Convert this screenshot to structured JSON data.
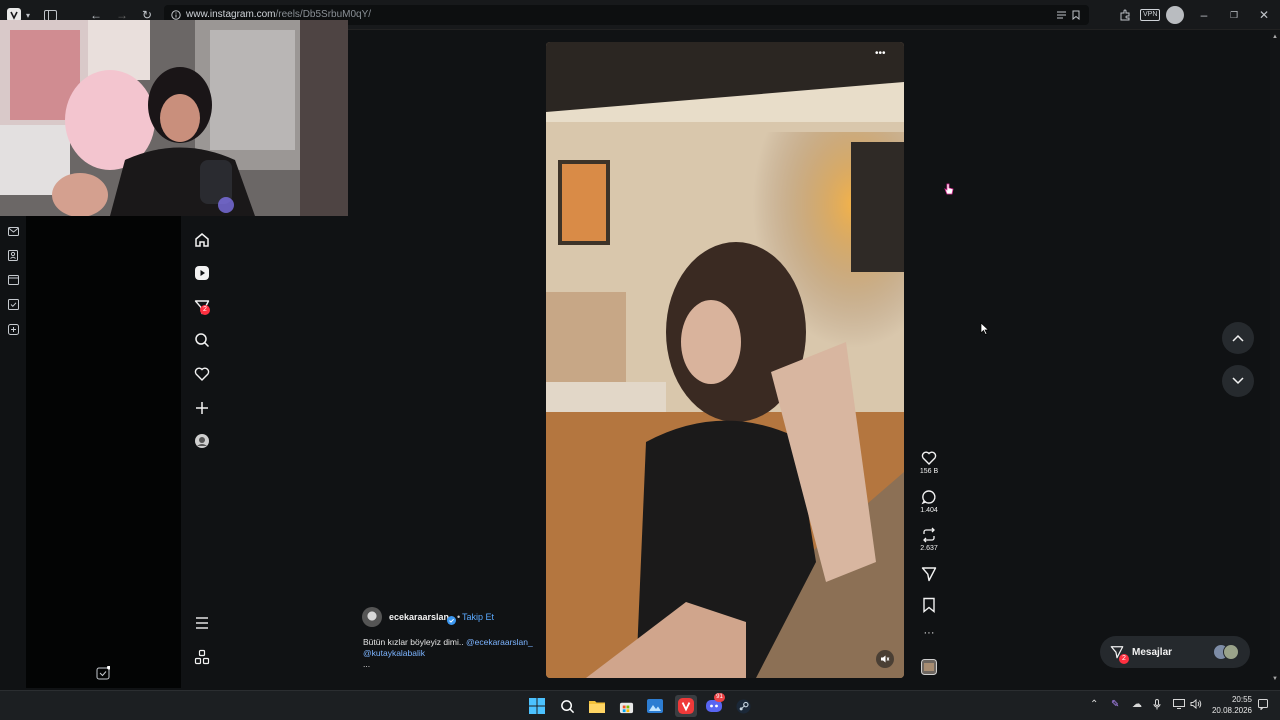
{
  "browser": {
    "url_host": "www.instagram.com",
    "url_path": "/reels/Db5SrbuM0qY/",
    "vpn_label": "VPN"
  },
  "nav": {
    "notification_count": "2",
    "items": [
      "home",
      "reels",
      "messages",
      "search",
      "notifications",
      "create",
      "profile"
    ]
  },
  "reel": {
    "author": "ecekaraarslan_",
    "verified": true,
    "follow_label": "Takip Et",
    "caption_text": "Bütün kızlar böyleyiz dimi.. ",
    "mention_1": "@ecekaraarslan_",
    "mention_2": "@kutaykalabalik",
    "caption_more": "...",
    "likes": "156 B",
    "comments": "1.404",
    "reposts": "2.637"
  },
  "messages": {
    "label": "Mesajlar",
    "badge": "2"
  },
  "taskbar": {
    "discord_badge": "91",
    "time": "20:55",
    "date": "20.08.2026"
  },
  "colors": {
    "accent": "#5aa9ff",
    "badge": "#ff3040",
    "background": "#101214"
  }
}
